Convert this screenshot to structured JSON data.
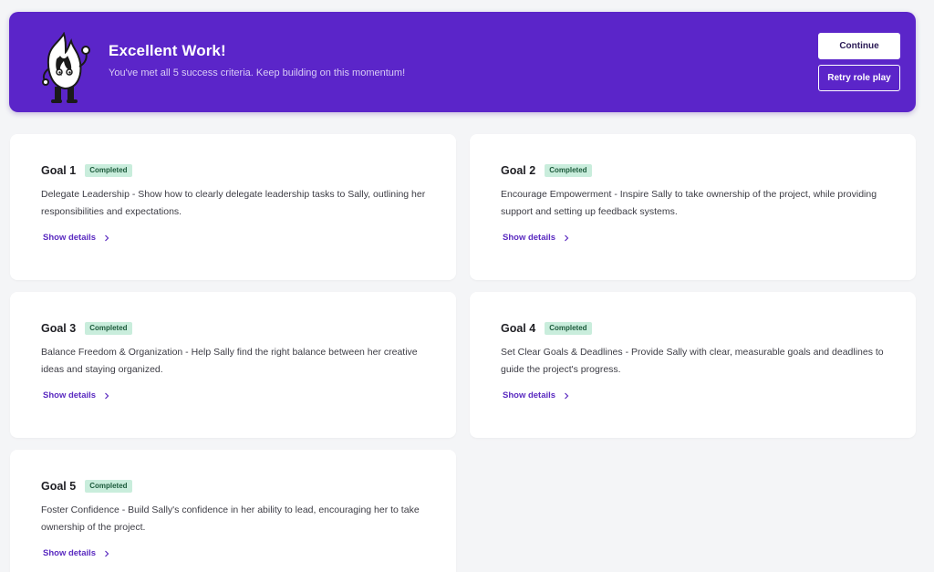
{
  "colors": {
    "banner": "#5b25c9",
    "badge_bg": "#c9eddc",
    "badge_text": "#1d5b3c",
    "link": "#5a2ac0",
    "page_bg": "#f4f5f7"
  },
  "banner": {
    "title": "Excellent Work!",
    "subtitle": "You've met all 5 success criteria. Keep building on this momentum!",
    "mascot_icon": "flame-mascot-icon",
    "continue_label": "Continue",
    "retry_label": "Retry role play"
  },
  "goals": [
    {
      "title": "Goal 1",
      "status": "Completed",
      "description": "Delegate Leadership - Show how to clearly delegate leadership tasks to Sally, outlining her responsibilities and expectations.",
      "link": "Show details"
    },
    {
      "title": "Goal 2",
      "status": "Completed",
      "description": "Encourage Empowerment - Inspire Sally to take ownership of the project, while providing support and setting up feedback systems.",
      "link": "Show details"
    },
    {
      "title": "Goal 3",
      "status": "Completed",
      "description": "Balance Freedom & Organization - Help Sally find the right balance between her creative ideas and staying organized.",
      "link": "Show details"
    },
    {
      "title": "Goal 4",
      "status": "Completed",
      "description": "Set Clear Goals & Deadlines - Provide Sally with clear, measurable goals and deadlines to guide the project's progress.",
      "link": "Show details"
    },
    {
      "title": "Goal 5",
      "status": "Completed",
      "description": "Foster Confidence - Build Sally's confidence in her ability to lead, encouraging her to take ownership of the project.",
      "link": "Show details"
    }
  ]
}
